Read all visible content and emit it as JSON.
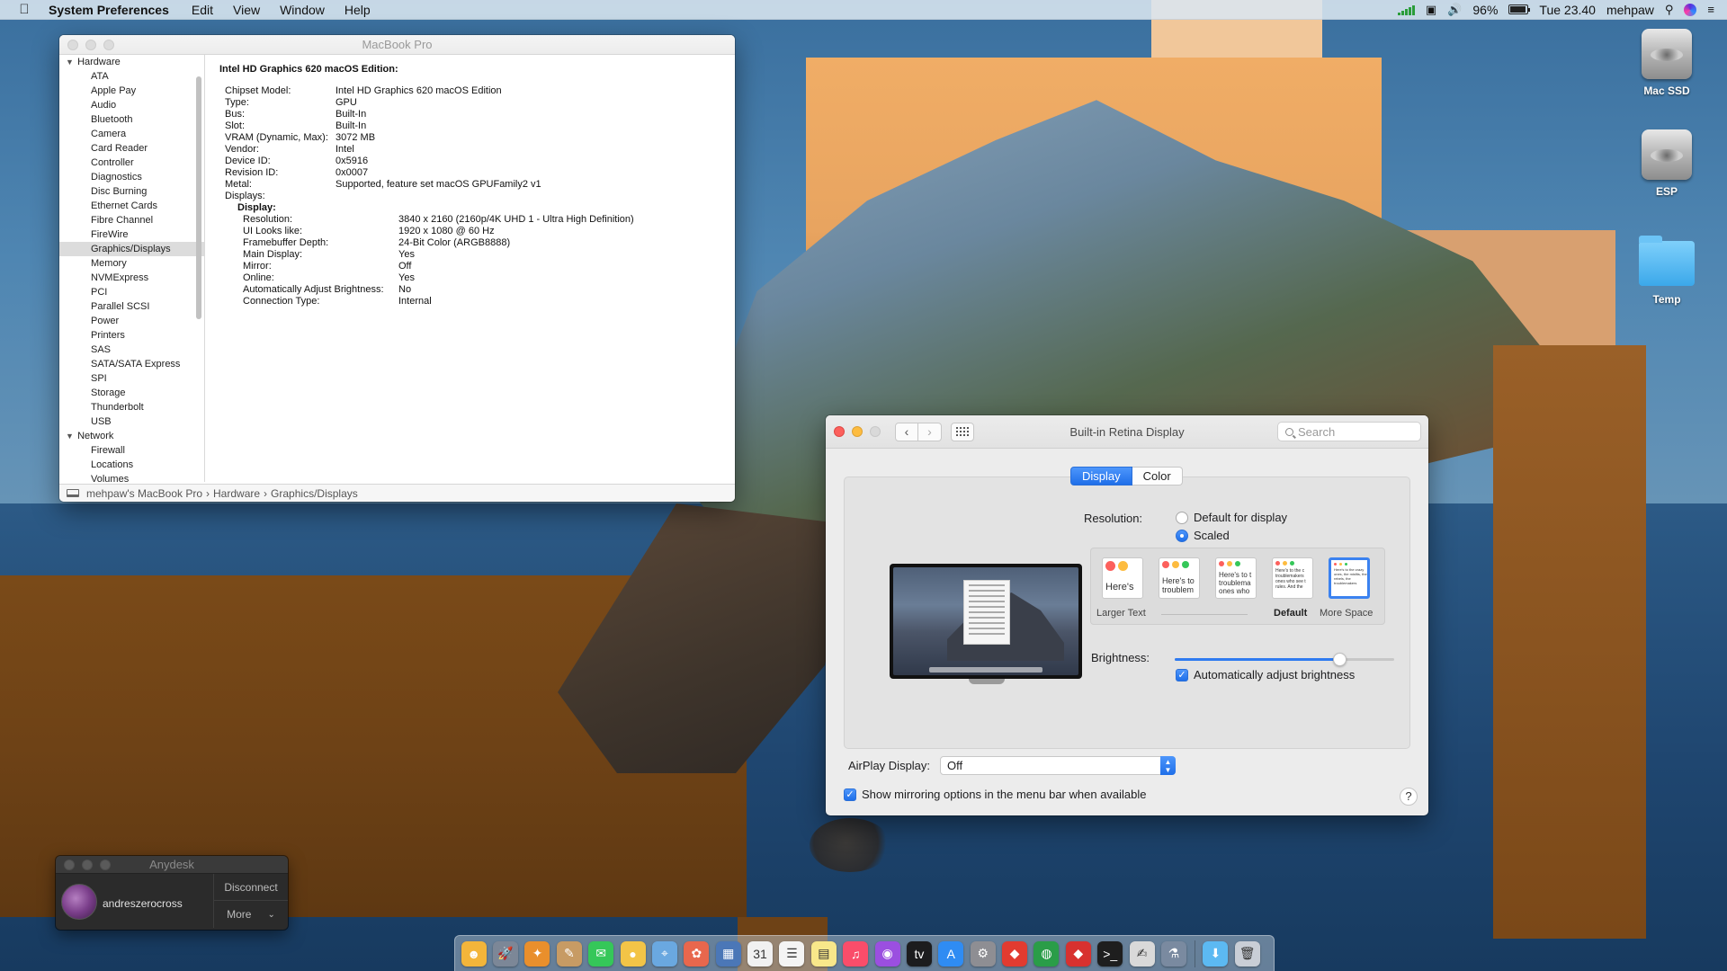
{
  "menubar": {
    "apple_icon": "apple-icon",
    "app_name": "System Preferences",
    "menus": [
      "Edit",
      "View",
      "Window",
      "Help"
    ],
    "battery": "96%",
    "battery_level": 0.96,
    "clock": "Tue 23.40",
    "user": "mehpaw"
  },
  "desktop": {
    "icons": [
      {
        "label": "Mac SSD",
        "type": "disk-icon"
      },
      {
        "label": "ESP",
        "type": "disk-icon"
      },
      {
        "label": "Temp",
        "type": "folder-icon"
      }
    ]
  },
  "sysinfo": {
    "title": "MacBook Pro",
    "sidebar": {
      "group_hardware": "Hardware",
      "hardware_items": [
        "ATA",
        "Apple Pay",
        "Audio",
        "Bluetooth",
        "Camera",
        "Card Reader",
        "Controller",
        "Diagnostics",
        "Disc Burning",
        "Ethernet Cards",
        "Fibre Channel",
        "FireWire",
        "Graphics/Displays",
        "Memory",
        "NVMExpress",
        "PCI",
        "Parallel SCSI",
        "Power",
        "Printers",
        "SAS",
        "SATA/SATA Express",
        "SPI",
        "Storage",
        "Thunderbolt",
        "USB"
      ],
      "selected": "Graphics/Displays",
      "group_network": "Network",
      "network_items": [
        "Firewall",
        "Locations",
        "Volumes"
      ]
    },
    "heading": "Intel HD Graphics 620 macOS Edition:",
    "details": [
      {
        "k": "Chipset Model:",
        "v": "Intel HD Graphics 620 macOS Edition"
      },
      {
        "k": "Type:",
        "v": "GPU"
      },
      {
        "k": "Bus:",
        "v": "Built-In"
      },
      {
        "k": "Slot:",
        "v": "Built-In"
      },
      {
        "k": "VRAM (Dynamic, Max):",
        "v": "3072 MB"
      },
      {
        "k": "Vendor:",
        "v": "Intel"
      },
      {
        "k": "Device ID:",
        "v": "0x5916"
      },
      {
        "k": "Revision ID:",
        "v": "0x0007"
      },
      {
        "k": "Metal:",
        "v": "Supported, feature set macOS GPUFamily2 v1"
      },
      {
        "k": "Displays:",
        "v": ""
      }
    ],
    "display_label": "Display:",
    "display_details": [
      {
        "k": "Resolution:",
        "v": "3840 x 2160 (2160p/4K UHD 1 - Ultra High Definition)"
      },
      {
        "k": "UI Looks like:",
        "v": "1920 x 1080 @ 60 Hz"
      },
      {
        "k": "Framebuffer Depth:",
        "v": "24-Bit Color (ARGB8888)"
      },
      {
        "k": "Main Display:",
        "v": "Yes"
      },
      {
        "k": "Mirror:",
        "v": "Off"
      },
      {
        "k": "Online:",
        "v": "Yes"
      },
      {
        "k": "Automatically Adjust Brightness:",
        "v": "No"
      },
      {
        "k": "Connection Type:",
        "v": "Internal"
      }
    ],
    "path": [
      "mehpaw's MacBook Pro",
      "Hardware",
      "Graphics/Displays"
    ],
    "path_sep": "›"
  },
  "display_prefs": {
    "title": "Built-in Retina Display",
    "search_placeholder": "Search",
    "tabs": {
      "display": "Display",
      "color": "Color"
    },
    "resolution_label": "Resolution:",
    "resolution_options": {
      "default": "Default for display",
      "scaled": "Scaled"
    },
    "selected_resolution": "scaled",
    "scale_thumbs": [
      {
        "text": "Here's"
      },
      {
        "text": "Here's to troublem"
      },
      {
        "text": "Here's to t troublema ones who"
      },
      {
        "text": "Here's to the c troublemakers ones who see t rules. And the"
      },
      {
        "text": "Here's to the crazy ones, the misfits, the rebels, the troublemakers"
      }
    ],
    "scale_labels": {
      "larger": "Larger Text",
      "default": "Default",
      "more": "More Space"
    },
    "brightness_label": "Brightness:",
    "brightness_level": 0.75,
    "auto_brightness": "Automatically adjust brightness",
    "airplay_label": "AirPlay Display:",
    "airplay_value": "Off",
    "mirroring": "Show mirroring options in the menu bar when available",
    "help": "?"
  },
  "anydesk": {
    "title": "Anydesk",
    "user": "andreszerocross",
    "disconnect": "Disconnect",
    "more": "More"
  },
  "dock": {
    "apps": [
      {
        "name": "finder-icon",
        "color": "#f3b53a",
        "glyph": "☻"
      },
      {
        "name": "launchpad-icon",
        "color": "#7c8797",
        "glyph": "🚀"
      },
      {
        "name": "safari-icon",
        "color": "#e98f2c",
        "glyph": "✦"
      },
      {
        "name": "preview-icon",
        "color": "#c79b64",
        "glyph": "✎"
      },
      {
        "name": "messages-icon",
        "color": "#35c759",
        "glyph": "✉"
      },
      {
        "name": "messages-alt-icon",
        "color": "#f3c447",
        "glyph": "●"
      },
      {
        "name": "maps-icon",
        "color": "#6aa8e0",
        "glyph": "⌖"
      },
      {
        "name": "photos-icon",
        "color": "#e8674d",
        "glyph": "✿"
      },
      {
        "name": "notes-board-icon",
        "color": "#4b77b7",
        "glyph": "▦"
      },
      {
        "name": "calendar-icon",
        "color": "#f1f1f1",
        "glyph": "31"
      },
      {
        "name": "reminders-icon",
        "color": "#f4f4f4",
        "glyph": "☰"
      },
      {
        "name": "notes-icon",
        "color": "#f8e78a",
        "glyph": "▤"
      },
      {
        "name": "music-icon",
        "color": "#fa4d6a",
        "glyph": "♫"
      },
      {
        "name": "podcasts-icon",
        "color": "#9b4fe0",
        "glyph": "◉"
      },
      {
        "name": "tv-icon",
        "color": "#1c1c1e",
        "glyph": "tv"
      },
      {
        "name": "app-store-icon",
        "color": "#2f8cf3",
        "glyph": "A"
      },
      {
        "name": "system-preferences-icon",
        "color": "#8e8e93",
        "glyph": "⚙"
      },
      {
        "name": "anydesk-icon",
        "color": "#e23b30",
        "glyph": "◆"
      },
      {
        "name": "browser-globe-icon",
        "color": "#2a9d48",
        "glyph": "◍"
      },
      {
        "name": "anydesk-alt-icon",
        "color": "#d8312f",
        "glyph": "◆"
      },
      {
        "name": "terminal-icon",
        "color": "#1e1e1e",
        "glyph": ">_"
      },
      {
        "name": "script-editor-icon",
        "color": "#d9d9d9",
        "glyph": "✍"
      },
      {
        "name": "automator-icon",
        "color": "#7a8aa0",
        "glyph": "⚗"
      }
    ],
    "right": [
      {
        "name": "downloads-folder-icon",
        "color": "#5cb9f2",
        "glyph": "⬇"
      },
      {
        "name": "trash-icon",
        "color": "#c9ced6",
        "glyph": "🗑"
      }
    ]
  }
}
